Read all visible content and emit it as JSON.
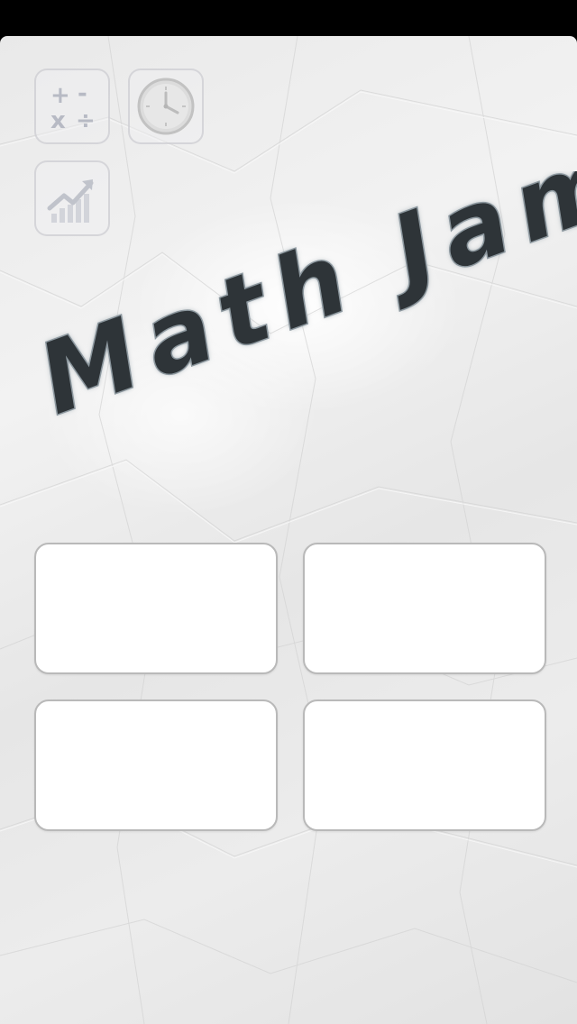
{
  "app": {
    "title": "Math Jam"
  },
  "toolbar": {
    "operations_icon": "operations-icon",
    "clock_icon": "clock-icon",
    "stats_icon": "stats-chart-icon",
    "operation_symbols": [
      "+",
      "-",
      "x",
      "÷"
    ]
  },
  "colors": {
    "title_ink": "#2e3438",
    "title_glow": "#9aa6ad",
    "icon_ink": "#b7bac4",
    "card_border": "#b9b9b9"
  },
  "menu": {
    "cards": [
      "",
      "",
      "",
      ""
    ]
  }
}
